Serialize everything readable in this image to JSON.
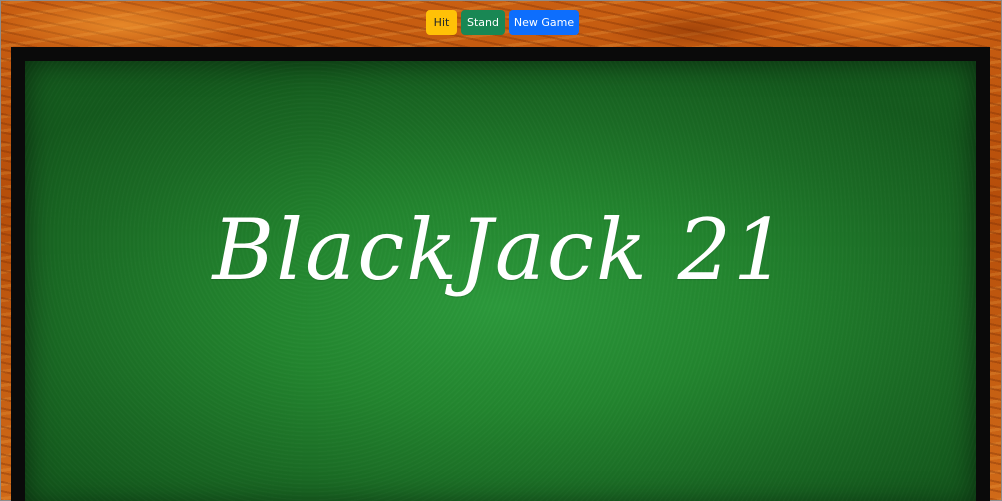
{
  "controls": {
    "hit_label": "Hit",
    "stand_label": "Stand",
    "new_game_label": "New Game"
  },
  "table": {
    "title": "BlackJack 21"
  },
  "colors": {
    "hit": "#ffc107",
    "stand": "#198754",
    "new_game": "#0d6efd",
    "felt": "#23862f",
    "wood": "#c95f12",
    "table_border": "#0a0a0a"
  }
}
